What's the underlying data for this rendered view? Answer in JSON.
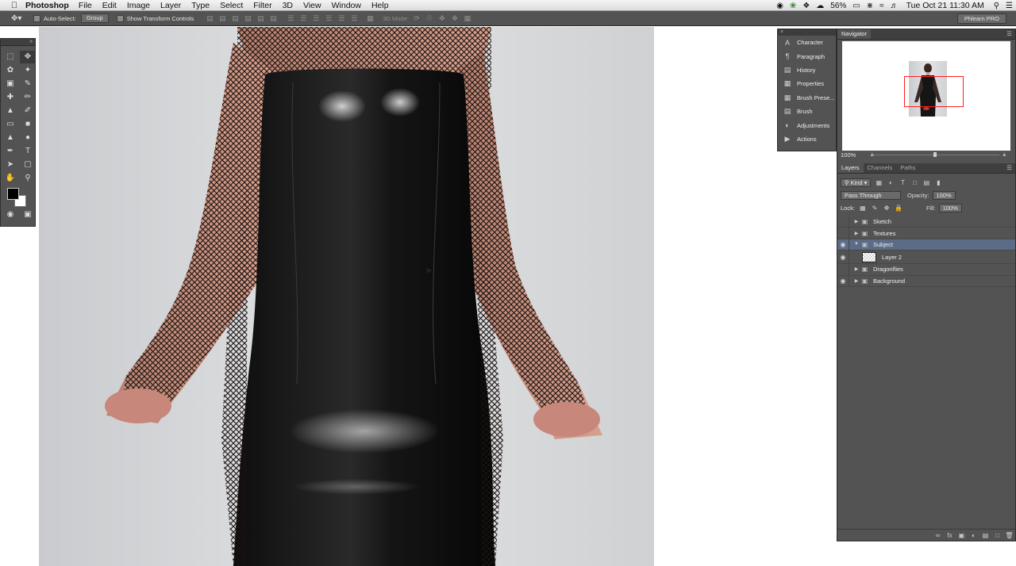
{
  "menubar": {
    "app_name": "Photoshop",
    "menus": [
      "File",
      "Edit",
      "Image",
      "Layer",
      "Type",
      "Select",
      "Filter",
      "3D",
      "View",
      "Window",
      "Help"
    ],
    "battery": "56%",
    "clock": "Tue Oct 21  11:30 AM"
  },
  "options_bar": {
    "auto_select_label": "Auto-Select:",
    "auto_select_value": "Group",
    "transform_label": "Show Transform Controls",
    "mode_label": "3D Mode:",
    "workspace": "Phlearn PRO"
  },
  "icon_panel": {
    "items": [
      {
        "label": "Character",
        "icon": "character-icon"
      },
      {
        "label": "Paragraph",
        "icon": "paragraph-icon"
      },
      {
        "label": "History",
        "icon": "history-icon"
      },
      {
        "label": "Properties",
        "icon": "properties-icon"
      },
      {
        "label": "Brush Prese...",
        "icon": "brush-presets-icon"
      },
      {
        "label": "Brush",
        "icon": "brush-icon"
      },
      {
        "label": "Adjustments",
        "icon": "adjustments-icon"
      },
      {
        "label": "Actions",
        "icon": "actions-icon"
      }
    ]
  },
  "navigator": {
    "tab": "Navigator",
    "zoom": "100%",
    "view_rect_color": "#ff2020"
  },
  "layers": {
    "tabs": [
      "Layers",
      "Channels",
      "Paths"
    ],
    "filter_kind": "Kind",
    "blend_mode": "Pass Through",
    "opacity_label": "Opacity:",
    "opacity_value": "100%",
    "lock_label": "Lock:",
    "fill_label": "Fill:",
    "fill_value": "100%",
    "items": [
      {
        "name": "Sketch",
        "type": "group",
        "visible": false,
        "selected": false
      },
      {
        "name": "Textures",
        "type": "group",
        "visible": false,
        "selected": false
      },
      {
        "name": "Subject",
        "type": "group",
        "visible": true,
        "selected": true,
        "expanded": true
      },
      {
        "name": "Layer 2",
        "type": "layer",
        "visible": true,
        "selected": false
      },
      {
        "name": "Dragonflies",
        "type": "group",
        "visible": false,
        "selected": false
      },
      {
        "name": "Background",
        "type": "group",
        "visible": true,
        "selected": false
      }
    ]
  },
  "colors": {
    "foreground": "#000000",
    "background": "#ffffff",
    "selection": "#5d6c86"
  }
}
